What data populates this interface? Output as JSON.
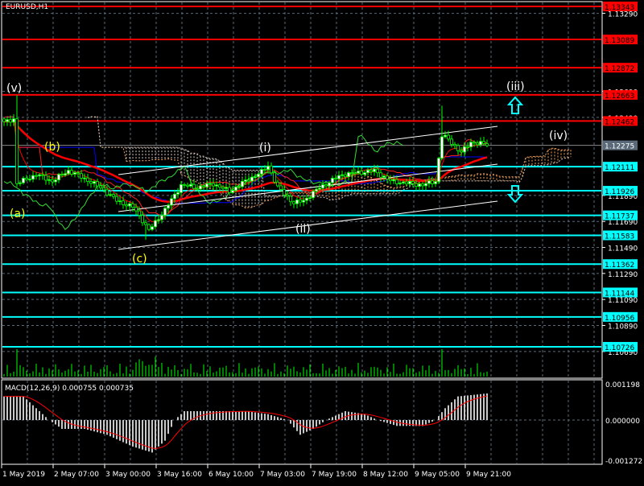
{
  "window": {
    "symbol_title": "EURUSD,H1"
  },
  "colors": {
    "resistance": "#ff0000",
    "support": "#00ffff",
    "current": "#5a6a78",
    "candle": "#00ff00",
    "grid": "#5a6a78",
    "cloud": "#f4a460",
    "blue_line": "#0000ff"
  },
  "price_axis": {
    "ticks": [
      "1.13290",
      "1.12690",
      "1.12490",
      "1.11890",
      "1.11690",
      "1.11490",
      "1.11290",
      "1.11090",
      "1.10890",
      "1.10690"
    ],
    "tick_values": [
      1.1329,
      1.1269,
      1.1249,
      1.1189,
      1.1169,
      1.1149,
      1.1129,
      1.1109,
      1.1089,
      1.1069
    ]
  },
  "levels": [
    {
      "label": "1.13343",
      "value": 1.13343,
      "type": "resistance"
    },
    {
      "label": "1.13089",
      "value": 1.13089,
      "type": "resistance"
    },
    {
      "label": "1.12872",
      "value": 1.12872,
      "type": "resistance"
    },
    {
      "label": "1.12663",
      "value": 1.12663,
      "type": "resistance"
    },
    {
      "label": "1.12462",
      "value": 1.12462,
      "type": "resistance"
    },
    {
      "label": "1.12275",
      "value": 1.12275,
      "type": "current"
    },
    {
      "label": "1.12111",
      "value": 1.12111,
      "type": "support"
    },
    {
      "label": "1.11926",
      "value": 1.11926,
      "type": "support"
    },
    {
      "label": "1.11737",
      "value": 1.11737,
      "type": "support"
    },
    {
      "label": "1.11583",
      "value": 1.11583,
      "type": "support"
    },
    {
      "label": "1.11362",
      "value": 1.11362,
      "type": "support"
    },
    {
      "label": "1.11144",
      "value": 1.11144,
      "type": "support"
    },
    {
      "label": "1.10956",
      "value": 1.10956,
      "type": "support"
    },
    {
      "label": "1.10726",
      "value": 1.10726,
      "type": "support"
    }
  ],
  "time_axis": [
    "1 May 2019",
    "2 May 07:00",
    "3 May 00:00",
    "3 May 16:00",
    "6 May 10:00",
    "7 May 03:00",
    "7 May 19:00",
    "8 May 12:00",
    "9 May 05:00",
    "9 May 21:00"
  ],
  "wave_labels": [
    {
      "text": "(v)",
      "color": "#ffffff"
    },
    {
      "text": "(a)",
      "color": "#ffff00"
    },
    {
      "text": "(b)",
      "color": "#ffff00"
    },
    {
      "text": "(c)",
      "color": "#ffff00"
    },
    {
      "text": "(i)",
      "color": "#ffffff"
    },
    {
      "text": "(ii)",
      "color": "#ffffff"
    },
    {
      "text": "(iii)",
      "color": "#ffffff"
    },
    {
      "text": "(iv)",
      "color": "#ffffff"
    }
  ],
  "macd": {
    "title": "MACD(12,26,9) 0.000755 0.000735",
    "axis": [
      "0.001198",
      "0.000000",
      "-0.001272"
    ],
    "histogram_path": [
      [
        0,
        0.0008
      ],
      [
        6,
        0.0008
      ],
      [
        12,
        0.0002
      ],
      [
        14,
        0.0
      ],
      [
        18,
        -0.0003
      ],
      [
        25,
        -0.0003
      ],
      [
        32,
        -0.0005
      ],
      [
        40,
        -0.0009
      ],
      [
        46,
        -0.0011
      ],
      [
        50,
        -0.0007
      ],
      [
        53,
        0.0
      ],
      [
        56,
        0.0003
      ],
      [
        75,
        0.0003
      ],
      [
        82,
        0.0002
      ],
      [
        88,
        0.0
      ],
      [
        92,
        -0.0005
      ],
      [
        96,
        -0.0003
      ],
      [
        100,
        0.0
      ],
      [
        106,
        0.0003
      ],
      [
        112,
        0.0002
      ],
      [
        116,
        0.0
      ],
      [
        122,
        -0.0002
      ],
      [
        130,
        -0.0002
      ],
      [
        134,
        0.0
      ],
      [
        137,
        0.0004
      ],
      [
        141,
        0.0008
      ],
      [
        150,
        0.0009
      ]
    ]
  },
  "chart_data": {
    "type": "candlestick",
    "title": "EURUSD,H1",
    "ylim": [
      1.1053,
      1.1338
    ],
    "price_path": [
      [
        0,
        1.1245
      ],
      [
        3,
        1.1248
      ],
      [
        4,
        1.1198
      ],
      [
        10,
        1.1205
      ],
      [
        15,
        1.12
      ],
      [
        20,
        1.1208
      ],
      [
        25,
        1.1202
      ],
      [
        30,
        1.1195
      ],
      [
        35,
        1.1185
      ],
      [
        40,
        1.118
      ],
      [
        43,
        1.117
      ],
      [
        45,
        1.1162
      ],
      [
        50,
        1.1178
      ],
      [
        55,
        1.1197
      ],
      [
        60,
        1.1195
      ],
      [
        65,
        1.1198
      ],
      [
        70,
        1.1192
      ],
      [
        75,
        1.12
      ],
      [
        80,
        1.1207
      ],
      [
        82,
        1.1212
      ],
      [
        85,
        1.1195
      ],
      [
        90,
        1.1183
      ],
      [
        93,
        1.1185
      ],
      [
        98,
        1.1195
      ],
      [
        105,
        1.1205
      ],
      [
        115,
        1.1208
      ],
      [
        120,
        1.12
      ],
      [
        130,
        1.1197
      ],
      [
        134,
        1.12
      ],
      [
        136,
        1.1235
      ],
      [
        138,
        1.1232
      ],
      [
        142,
        1.1222
      ],
      [
        145,
        1.123
      ],
      [
        150,
        1.1228
      ]
    ],
    "bars": 151
  }
}
